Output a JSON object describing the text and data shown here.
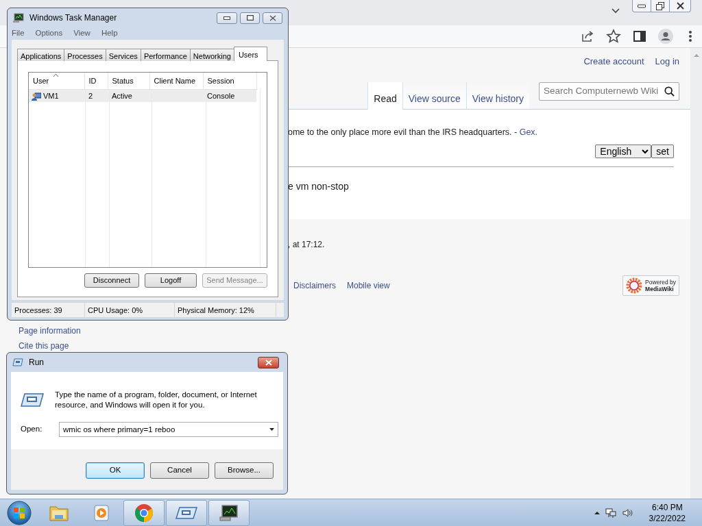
{
  "browser": {
    "page": {
      "personal_links": [
        "Create account",
        "Log in"
      ],
      "tabs": [
        {
          "label": "Read",
          "selected": true
        },
        {
          "label": "View source",
          "selected": false
        },
        {
          "label": "View history",
          "selected": false
        }
      ],
      "search": {
        "placeholder": "Search Computernewb Wiki"
      },
      "quote": {
        "text": "ome to the only place more evil than the IRS headquarters. - ",
        "link": "Gex."
      },
      "language_select": {
        "value": "English"
      },
      "set_button": "set",
      "body_text": "e vm non-stop",
      "last_modified": ", at 17:12.",
      "sidebar_links": [
        "Page information",
        "Cite this page"
      ],
      "footer_links": [
        "Disclaimers",
        "Mobile view"
      ],
      "powered_by": {
        "line_1": "Powered by",
        "line_2": "MediaWiki"
      }
    }
  },
  "task_manager": {
    "title": "Windows Task Manager",
    "menu": [
      "File",
      "Options",
      "View",
      "Help"
    ],
    "tabs": [
      {
        "label": "Applications",
        "selected": false
      },
      {
        "label": "Processes",
        "selected": false
      },
      {
        "label": "Services",
        "selected": false
      },
      {
        "label": "Performance",
        "selected": false
      },
      {
        "label": "Networking",
        "selected": false
      },
      {
        "label": "Users",
        "selected": true
      }
    ],
    "table": {
      "columns": [
        {
          "label": "User",
          "sorted": true
        },
        {
          "label": "ID",
          "sorted": false
        },
        {
          "label": "Status",
          "sorted": false
        },
        {
          "label": "Client Name",
          "sorted": false
        },
        {
          "label": "Session",
          "sorted": false
        }
      ],
      "rows": [
        {
          "user": "VM1",
          "id": "2",
          "status": "Active",
          "session": "Console",
          "selected": true
        }
      ]
    },
    "buttons": [
      {
        "label": "Disconnect",
        "disabled": false
      },
      {
        "label": "Logoff",
        "disabled": false
      },
      {
        "label": "Send Message...",
        "disabled": true
      }
    ],
    "status_bar": [
      "Processes: 39",
      "CPU Usage: 0%",
      "Physical Memory: 12%"
    ]
  },
  "run_dialog": {
    "title": "Run",
    "description": "Type the name of a program, folder, document, or Internet resource, and Windows will open it for you.",
    "open_label": "Open:",
    "value": "wmic os where primary=1 reboo",
    "buttons": [
      {
        "label": "OK",
        "default": true
      },
      {
        "label": "Cancel",
        "default": false
      },
      {
        "label": "Browse...",
        "default": false
      }
    ]
  },
  "taskbar": {
    "items": [
      {
        "kind": "folder",
        "running": false
      },
      {
        "kind": "media",
        "running": false
      },
      {
        "kind": "chrome",
        "running": true
      },
      {
        "kind": "run",
        "running": true
      },
      {
        "kind": "taskmgr",
        "running": true
      }
    ],
    "clock": {
      "time": "6:40 PM",
      "date": "3/22/2022"
    }
  }
}
